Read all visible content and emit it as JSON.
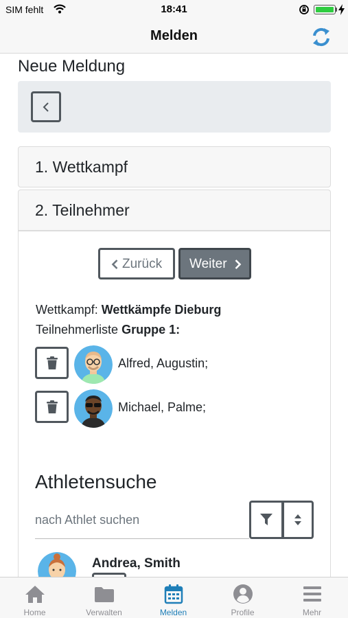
{
  "status_bar": {
    "carrier": "SIM fehlt",
    "time": "18:41"
  },
  "nav": {
    "title": "Melden",
    "refresh_icon": "refresh-icon"
  },
  "page": {
    "heading": "Neue Meldung"
  },
  "steps": [
    {
      "label": "1. Wettkampf"
    },
    {
      "label": "2. Teilnehmer"
    }
  ],
  "step2": {
    "back_label": "Zurück",
    "next_label": "Weiter",
    "competition_prefix": "Wettkampf:",
    "competition_name": "Wettkämpfe Dieburg",
    "list_prefix": "Teilnehmerliste",
    "group_name": "Gruppe 1:",
    "participants": [
      {
        "name": "Alfred, Augustin;"
      },
      {
        "name": "Michael, Palme;"
      }
    ]
  },
  "athlete_search": {
    "heading": "Athletensuche",
    "placeholder": "nach Athlet suchen",
    "value": "",
    "results": [
      {
        "name": "Andrea, Smith"
      }
    ]
  },
  "tabs": [
    {
      "label": "Home",
      "icon": "home-icon",
      "active": false
    },
    {
      "label": "Verwalten",
      "icon": "folder-icon",
      "active": false
    },
    {
      "label": "Melden",
      "icon": "calendar-icon",
      "active": true
    },
    {
      "label": "Profile",
      "icon": "user-circle-icon",
      "active": false
    },
    {
      "label": "Mehr",
      "icon": "menu-icon",
      "active": false
    }
  ],
  "colors": {
    "accent": "#1f7fb8",
    "refresh": "#3a8fcf",
    "button_border": "#50575d",
    "primary_button": "#6c757d",
    "battery": "#2ecc40"
  }
}
